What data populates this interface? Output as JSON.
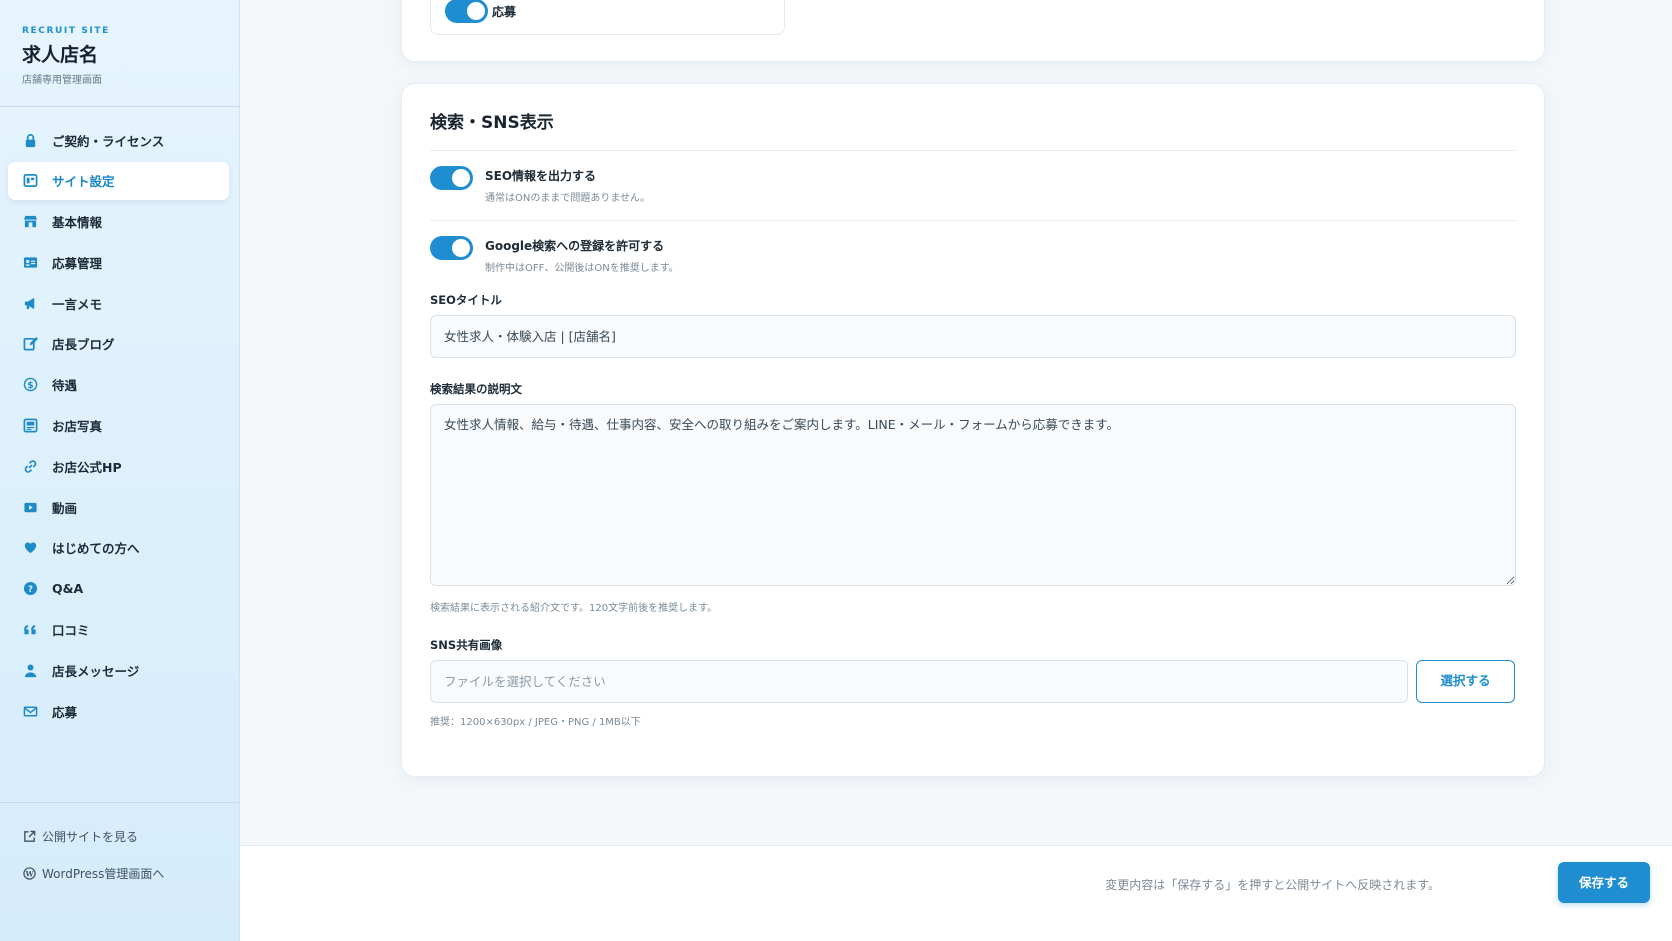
{
  "brand": {
    "kicker": "RECRUIT SITE",
    "title": "求人店名",
    "subtitle": "店舗専用管理画面"
  },
  "sidebar": {
    "items": [
      {
        "label": "ご契約・ライセンス",
        "icon": "lock-icon"
      },
      {
        "label": "サイト設定",
        "icon": "layout-icon",
        "active": true
      },
      {
        "label": "基本情報",
        "icon": "store-icon"
      },
      {
        "label": "応募管理",
        "icon": "id-card-icon"
      },
      {
        "label": "一言メモ",
        "icon": "megaphone-icon"
      },
      {
        "label": "店長ブログ",
        "icon": "edit-icon"
      },
      {
        "label": "待遇",
        "icon": "dollar-icon"
      },
      {
        "label": "お店写真",
        "icon": "image-icon"
      },
      {
        "label": "お店公式HP",
        "icon": "link-icon"
      },
      {
        "label": "動画",
        "icon": "play-icon"
      },
      {
        "label": "はじめての方へ",
        "icon": "heart-icon"
      },
      {
        "label": "Q&A",
        "icon": "question-icon"
      },
      {
        "label": "口コミ",
        "icon": "quote-icon"
      },
      {
        "label": "店長メッセージ",
        "icon": "user-icon"
      },
      {
        "label": "応募",
        "icon": "mail-icon"
      }
    ],
    "footer": {
      "view_site": "公開サイトを見る",
      "wp_admin": "WordPress管理画面へ"
    }
  },
  "top_card": {
    "toggle_label": "応募"
  },
  "seo_section": {
    "title": "検索・SNS表示",
    "toggles": [
      {
        "label": "SEO情報を出力する",
        "help": "通常はONのままで問題ありません。",
        "on": true
      },
      {
        "label": "Google検索への登録を許可する",
        "help": "制作中はOFF、公開後はONを推奨します。",
        "on": true
      }
    ],
    "seo_title": {
      "label": "SEOタイトル",
      "value": "女性求人・体験入店 | [店舗名]"
    },
    "description": {
      "label": "検索結果の説明文",
      "value": "女性求人情報、給与・待遇、仕事内容、安全への取り組みをご案内します。LINE・メール・フォームから応募できます。",
      "help": "検索結果に表示される紹介文です。120文字前後を推奨します。"
    },
    "sns_image": {
      "label": "SNS共有画像",
      "placeholder": "ファイルを選択してください",
      "button": "選択する",
      "help": "推奨：1200×630px / JPEG・PNG / 1MB以下"
    }
  },
  "footer_bar": {
    "note": "変更内容は「保存する」を押すと公開サイトへ反映されます。",
    "save_button": "保存する"
  },
  "colors": {
    "accent": "#1e8ed0",
    "sidebar_bg": "#dcf0fc",
    "page_bg": "#f3f7fa"
  }
}
